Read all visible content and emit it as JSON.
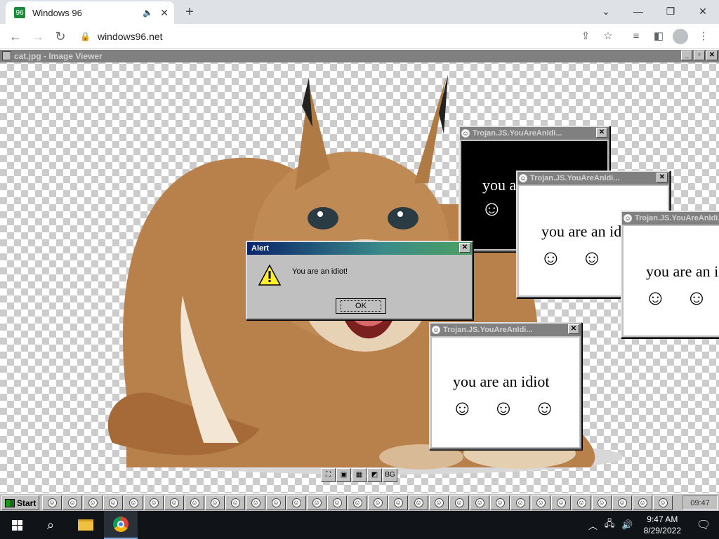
{
  "browser": {
    "tab_title": "Windows 96",
    "tab_favicon": "96",
    "url": "windows96.net"
  },
  "image_viewer": {
    "title": "cat.jpg - Image Viewer",
    "tools": [
      "",
      "",
      "",
      "",
      "BG"
    ]
  },
  "alert": {
    "title": "Alert",
    "message": "You are an idiot!",
    "ok_label": "OK"
  },
  "idiot_windows": [
    {
      "title": "Trojan.JS.YouAreAnIdi...",
      "text": "you are an idiot",
      "theme": "dark"
    },
    {
      "title": "Trojan.JS.YouAreAnIdi...",
      "text": "you are an idiot",
      "theme": "light"
    },
    {
      "title": "Trojan.JS.YouAreAnIdi...",
      "text": "you are an idiot",
      "theme": "light"
    },
    {
      "title": "Trojan.JS.YouAreAnIdi...",
      "text": "you are an idiot",
      "theme": "light"
    }
  ],
  "w96_taskbar": {
    "start_label": "Start",
    "clock": "09:47",
    "button_count": 31
  },
  "win10_taskbar": {
    "time": "9:47 AM",
    "date": "8/29/2022"
  },
  "colors": {
    "alert_gradient_start": "#0a246a",
    "alert_gradient_end": "#4aa060",
    "w96_face": "#c0c0c0"
  }
}
